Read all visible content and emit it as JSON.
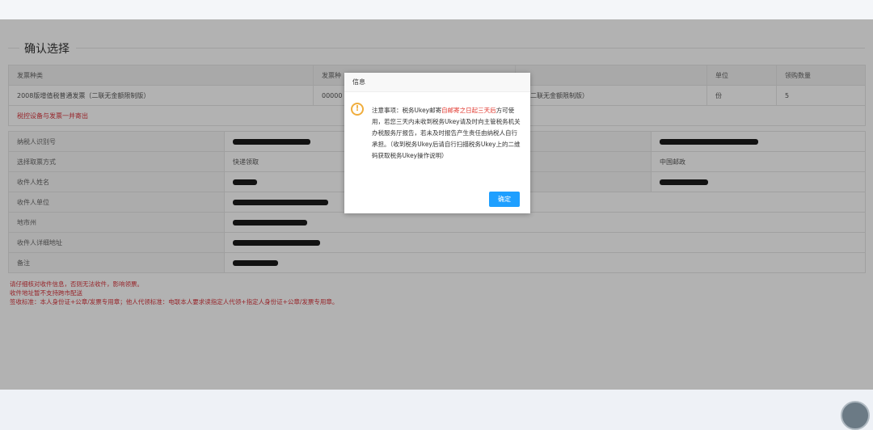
{
  "section": {
    "title": "确认选择"
  },
  "invoice_table": {
    "headers": [
      "发票种类",
      "发票种",
      "",
      "单位",
      "领购数量"
    ],
    "row": [
      "2008版增值税普通发票（二联无金额限制版）",
      "00000",
      "（二联无金额限制版）",
      "份",
      "5"
    ],
    "notice": "税控设备与发票一并寄出"
  },
  "recipient_table": {
    "taxpayer_id_label": "纳税人识别号",
    "pickup_method_label": "选择取票方式",
    "pickup_method_value": "快递领取",
    "carrier_value": "中国邮政",
    "recipient_name_label": "收件人姓名",
    "recipient_unit_label": "收件人单位",
    "city_label": "地市州",
    "address_label": "收件人详细地址",
    "remarks_label": "备注"
  },
  "notes": [
    "请仔细核对收件信息，否则无法收件，影响领票。",
    "收件地址暂不支持跨市配送",
    "签收标准：本人身份证+公章/发票专用章；他人代领标准：电联本人要求读指定人代领+指定人身份证+公章/发票专用章。"
  ],
  "dialog": {
    "title": "信息",
    "icon": "exclamation-icon",
    "message_part1": "注意事项：税务Ukey邮寄",
    "message_highlight": "自邮寄之日起三天后",
    "message_part2": "方可使用，若您三天内未收到税务Ukey请及时向主管税务机关办税服务厅报告，若未及时报告产生责任由纳税人自行承担。（收到税务Ukey后请自行扫描税务Ukey上的二维码获取税务Ukey操作说明）",
    "ok_label": "确定"
  },
  "colors": {
    "accent": "#1e9fff",
    "warning": "#f0ad3c",
    "alert_text": "#e0342b"
  }
}
